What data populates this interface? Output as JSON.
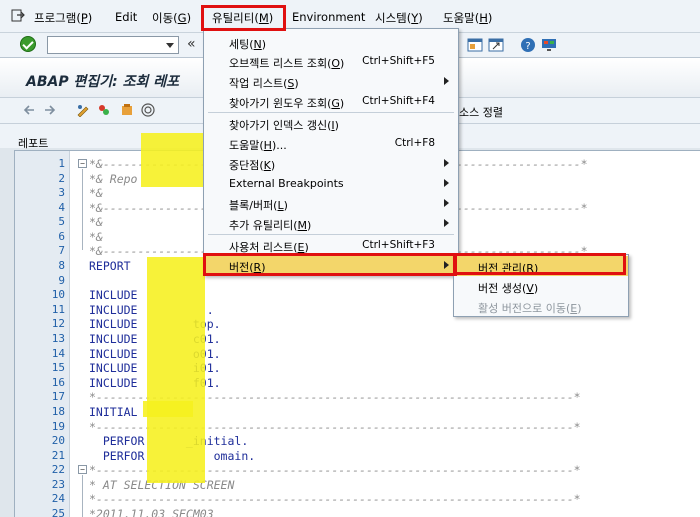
{
  "menubar": {
    "items": [
      {
        "label": "프로그램(",
        "key": "P",
        "end": ")"
      },
      {
        "label": "Edit",
        "key": "",
        "end": ""
      },
      {
        "label": "이동(",
        "key": "G",
        "end": ")"
      },
      {
        "label": "유틸리티(",
        "key": "M",
        "end": ")"
      },
      {
        "label": "Environment",
        "key": "",
        "end": ""
      },
      {
        "label": "시스템(",
        "key": "Y",
        "end": ")"
      },
      {
        "label": "도움말(",
        "key": "H",
        "end": ")"
      }
    ]
  },
  "toolbar": {
    "command_value": "",
    "rewind_glyph": "«"
  },
  "title": "ABAP 편집기: 조회 레포",
  "apptoolbar": {
    "sort_label": "소스 정렬"
  },
  "report_label": "레포트",
  "editor": {
    "lines": [
      {
        "no": "1",
        "text": "*&---------------------------------------------------------------------*",
        "comment": true
      },
      {
        "no": "2",
        "text": "*& Repo",
        "comment": true
      },
      {
        "no": "3",
        "text": "*&",
        "comment": true
      },
      {
        "no": "4",
        "text": "*&---------------------------------------------------------------------*",
        "comment": true
      },
      {
        "no": "5",
        "text": "*&",
        "comment": true
      },
      {
        "no": "6",
        "text": "*&",
        "comment": true
      },
      {
        "no": "7",
        "text": "*&---------------------------------------------------------------------*",
        "comment": true
      },
      {
        "no": "8",
        "text": "REPORT",
        "comment": false
      },
      {
        "no": "9",
        "text": "",
        "comment": false
      },
      {
        "no": "10",
        "text": "INCLUDE",
        "comment": false
      },
      {
        "no": "11",
        "text": "INCLUDE          .",
        "comment": false
      },
      {
        "no": "12",
        "text": "INCLUDE        top.",
        "comment": false
      },
      {
        "no": "13",
        "text": "INCLUDE        c01.",
        "comment": false
      },
      {
        "no": "14",
        "text": "INCLUDE        o01.",
        "comment": false
      },
      {
        "no": "15",
        "text": "INCLUDE        i01.",
        "comment": false
      },
      {
        "no": "16",
        "text": "INCLUDE        f01.",
        "comment": false
      },
      {
        "no": "17",
        "text": "*---------------------------------------------------------------------*",
        "comment": true
      },
      {
        "no": "18",
        "text": "INITIAL",
        "comment": false
      },
      {
        "no": "19",
        "text": "*---------------------------------------------------------------------*",
        "comment": true
      },
      {
        "no": "20",
        "text": "  PERFOR      _initial.",
        "comment": false
      },
      {
        "no": "21",
        "text": "  PERFOR          omain.",
        "comment": false
      },
      {
        "no": "22",
        "text": "*---------------------------------------------------------------------*",
        "comment": true
      },
      {
        "no": "23",
        "text": "* AT SELECTION SCREEN",
        "comment": true
      },
      {
        "no": "24",
        "text": "*---------------------------------------------------------------------*",
        "comment": true
      },
      {
        "no": "25",
        "text": "*2011.11.03 SECM03",
        "comment": true
      }
    ]
  },
  "utility_menu": {
    "items": [
      {
        "label": "세팅(",
        "key": "N",
        "end": ")",
        "shortcut": "",
        "submenu": false
      },
      {
        "label": "오브젝트 리스트 조회(",
        "key": "O",
        "end": ")",
        "shortcut": "Ctrl+Shift+F5",
        "submenu": false
      },
      {
        "label": "작업 리스트(",
        "key": "S",
        "end": ")",
        "shortcut": "",
        "submenu": true
      },
      {
        "label": "찾아가기 윈도우 조회(",
        "key": "G",
        "end": ")",
        "shortcut": "Ctrl+Shift+F4",
        "submenu": false
      },
      {
        "label": "찾아가기 인덱스 갱신(",
        "key": "I",
        "end": ")",
        "shortcut": "",
        "submenu": false
      },
      {
        "label": "도움말(",
        "key": "H",
        "end": ")...",
        "shortcut": "Ctrl+F8",
        "submenu": false
      },
      {
        "label": "중단점(",
        "key": "K",
        "end": ")",
        "shortcut": "",
        "submenu": true
      },
      {
        "label": "External Breakpoints",
        "key": "",
        "end": "",
        "shortcut": "",
        "submenu": true
      },
      {
        "label": "블록/버퍼(",
        "key": "L",
        "end": ")",
        "shortcut": "",
        "submenu": true
      },
      {
        "label": "추가 유틸리티(",
        "key": "M",
        "end": ")",
        "shortcut": "",
        "submenu": true
      },
      {
        "label": "사용처 리스트(",
        "key": "E",
        "end": ")",
        "shortcut": "Ctrl+Shift+F3",
        "submenu": false
      },
      {
        "label": "버전(",
        "key": "R",
        "end": ")",
        "shortcut": "",
        "submenu": true
      }
    ]
  },
  "version_submenu": {
    "items": [
      {
        "label": "버전 관리(",
        "key": "R",
        "end": ")",
        "disabled": false
      },
      {
        "label": "버전 생성(",
        "key": "V",
        "end": ")",
        "disabled": false
      },
      {
        "label": "활성 버전으로 이동(",
        "key": "E",
        "end": ")",
        "disabled": true
      }
    ]
  },
  "colors": {
    "highlight": "#f3d66a",
    "callout": "#e01010",
    "redaction": "#f6f01e"
  }
}
